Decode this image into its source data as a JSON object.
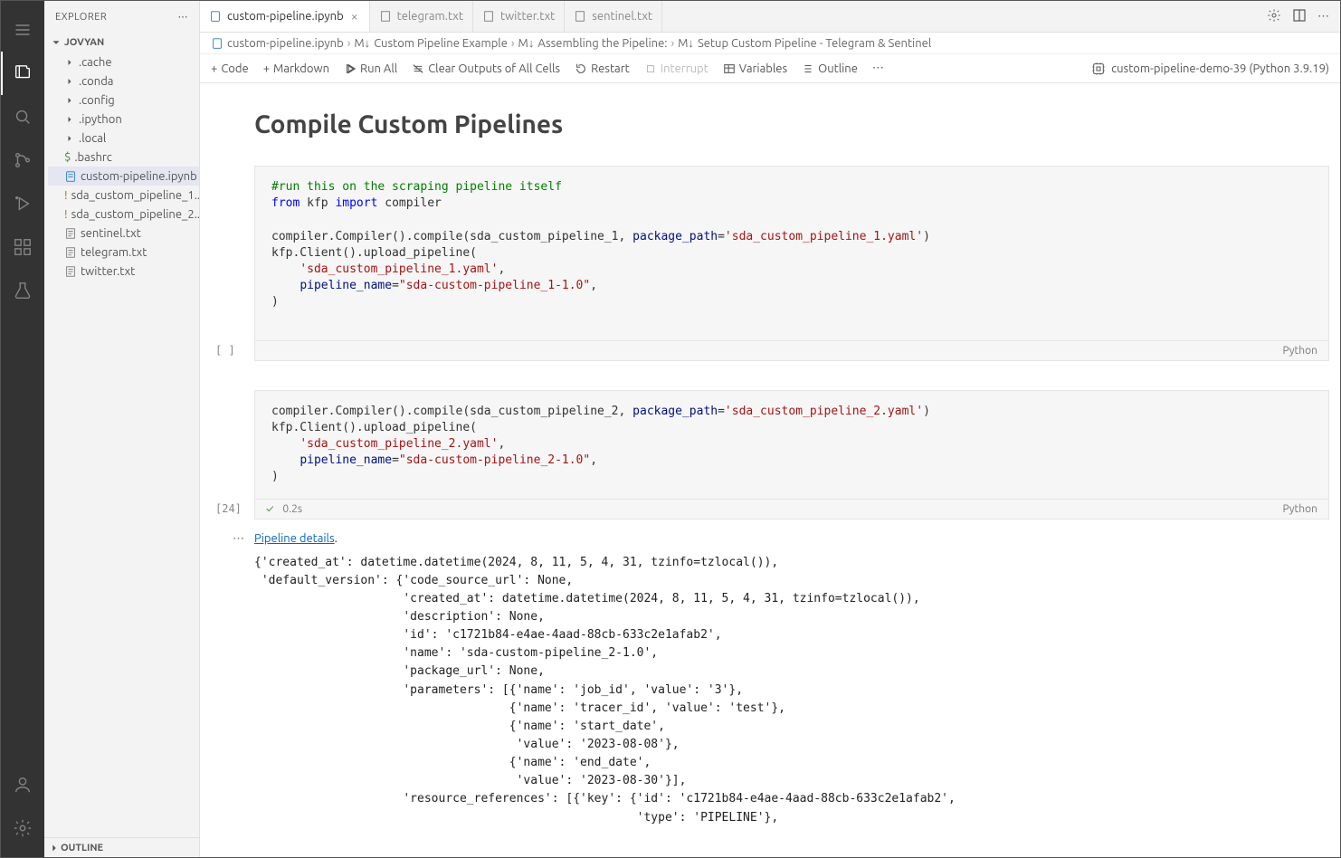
{
  "explorer": {
    "title": "EXPLORER",
    "root": "JOVYAN",
    "outline": "OUTLINE"
  },
  "files": {
    "cache": ".cache",
    "conda": ".conda",
    "config": ".config",
    "ipython": ".ipython",
    "local": ".local",
    "bashrc": ".bashrc",
    "custompipe": "custom-pipeline.ipynb",
    "sd1": "sda_custom_pipeline_1....",
    "sd2": "sda_custom_pipeline_2....",
    "sentinel": "sentinel.txt",
    "telegram": "telegram.txt",
    "twitter": "twitter.txt"
  },
  "tabs": {
    "t1": "custom-pipeline.ipynb",
    "t2": "telegram.txt",
    "t3": "twitter.txt",
    "t4": "sentinel.txt"
  },
  "breadcrumb": {
    "b1": "custom-pipeline.ipynb",
    "b2": "Custom Pipeline Example",
    "b3": "Assembling the Pipeline:",
    "b4": "Setup Custom Pipeline - Telegram & Sentinel"
  },
  "toolbar": {
    "code": "Code",
    "markdown": "Markdown",
    "runall": "Run All",
    "clear": "Clear Outputs of All Cells",
    "restart": "Restart",
    "interrupt": "Interrupt",
    "variables": "Variables",
    "outline": "Outline",
    "kernel": "custom-pipeline-demo-39 (Python 3.9.19)"
  },
  "heading": "Compile Custom Pipelines",
  "cell1": {
    "gutter": "[ ]",
    "lang": "Python"
  },
  "cell2": {
    "gutter": "[24]",
    "time": "0.2s",
    "lang": "Python"
  },
  "outlink": {
    "text": "Pipeline details",
    "dot": "."
  },
  "output": "{'created_at': datetime.datetime(2024, 8, 11, 5, 4, 31, tzinfo=tzlocal()),\n 'default_version': {'code_source_url': None,\n                     'created_at': datetime.datetime(2024, 8, 11, 5, 4, 31, tzinfo=tzlocal()),\n                     'description': None,\n                     'id': 'c1721b84-e4ae-4aad-88cb-633c2e1afab2',\n                     'name': 'sda-custom-pipeline_2-1.0',\n                     'package_url': None,\n                     'parameters': [{'name': 'job_id', 'value': '3'},\n                                    {'name': 'tracer_id', 'value': 'test'},\n                                    {'name': 'start_date',\n                                     'value': '2023-08-08'},\n                                    {'name': 'end_date',\n                                     'value': '2023-08-30'}],\n                     'resource_references': [{'key': {'id': 'c1721b84-e4ae-4aad-88cb-633c2e1afab2',\n                                                      'type': 'PIPELINE'},"
}
